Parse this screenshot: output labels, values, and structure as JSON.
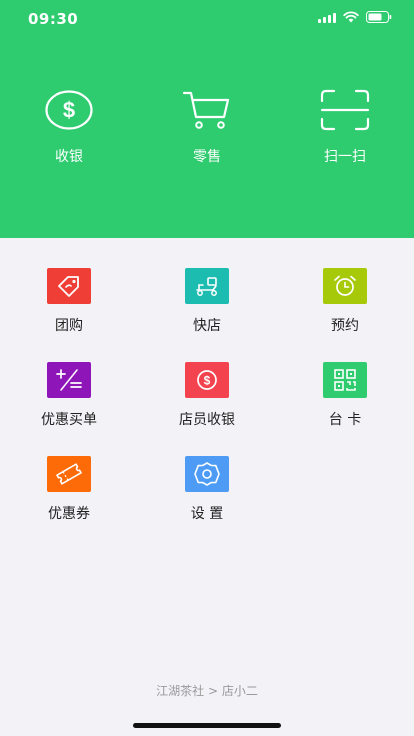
{
  "status_bar": {
    "time": "09:30"
  },
  "top_actions": [
    {
      "label": "收银",
      "icon": "dollar-circle-icon"
    },
    {
      "label": "零售",
      "icon": "shopping-cart-icon"
    },
    {
      "label": "扫一扫",
      "icon": "scan-icon"
    }
  ],
  "grid": [
    {
      "label": "团购",
      "icon": "price-tag-icon",
      "color": "#ef3e36"
    },
    {
      "label": "快店",
      "icon": "delivery-scooter-icon",
      "color": "#1dbcb0"
    },
    {
      "label": "预约",
      "icon": "alarm-clock-icon",
      "color": "#a6c90a"
    },
    {
      "label": "优惠买单",
      "icon": "discount-bill-icon",
      "color": "#8e16b8"
    },
    {
      "label": "店员收银",
      "icon": "dollar-circle-icon",
      "color": "#f2434e"
    },
    {
      "label": "台 卡",
      "icon": "qr-code-icon",
      "color": "#2ecb6f"
    },
    {
      "label": "优惠券",
      "icon": "coupon-icon",
      "color": "#fd6a08"
    },
    {
      "label": "设 置",
      "icon": "settings-gear-icon",
      "color": "#4e9bf5"
    }
  ],
  "footer": {
    "breadcrumb": "江湖茶社 > 店小二"
  },
  "colors": {
    "header_bg": "#2ecb6f",
    "page_bg": "#f2f2f7"
  }
}
